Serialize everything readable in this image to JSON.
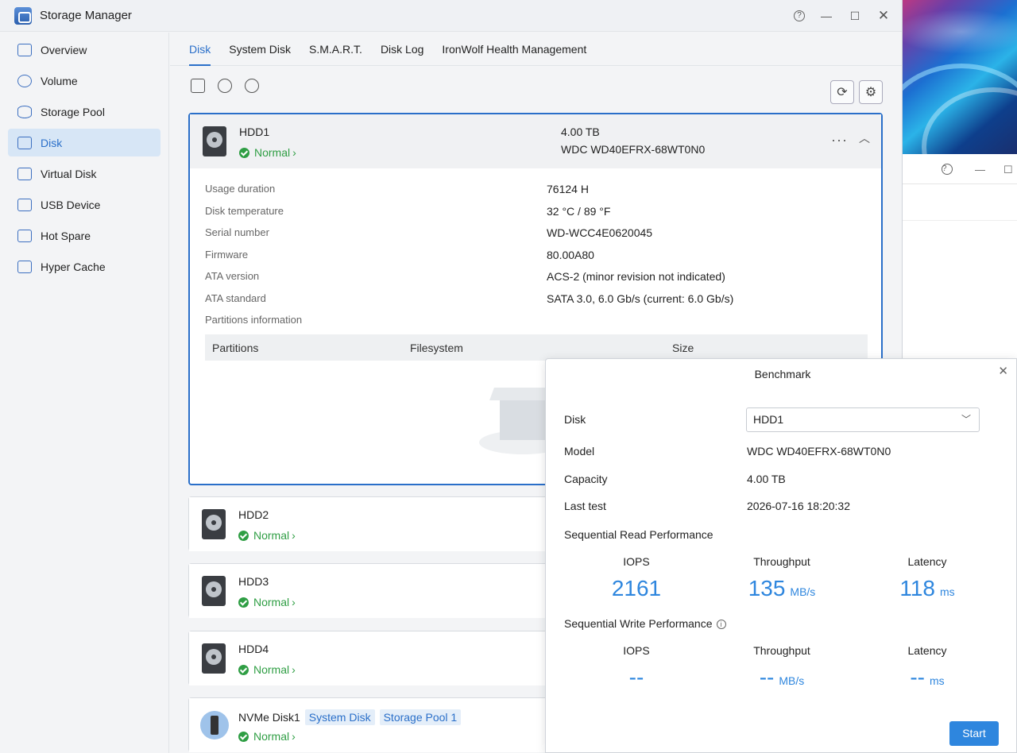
{
  "window": {
    "title": "Storage Manager"
  },
  "sidebar": {
    "items": [
      {
        "label": "Overview",
        "icon": "monitor-icon"
      },
      {
        "label": "Volume",
        "icon": "volume-icon"
      },
      {
        "label": "Storage Pool",
        "icon": "database-icon"
      },
      {
        "label": "Disk",
        "icon": "disk-icon",
        "active": true
      },
      {
        "label": "Virtual Disk",
        "icon": "virtual-disk-icon"
      },
      {
        "label": "USB Device",
        "icon": "usb-icon"
      },
      {
        "label": "Hot Spare",
        "icon": "hot-spare-icon"
      },
      {
        "label": "Hyper Cache",
        "icon": "ssd-icon"
      }
    ]
  },
  "tabs": [
    "Disk",
    "System Disk",
    "S.M.A.R.T.",
    "Disk Log",
    "IronWolf Health Management"
  ],
  "disks": [
    {
      "name": "HDD1",
      "status": "Normal",
      "capacity": "4.00 TB",
      "model": "WDC WD40EFRX-68WT0N0"
    },
    {
      "name": "HDD2",
      "status": "Normal"
    },
    {
      "name": "HDD3",
      "status": "Normal"
    },
    {
      "name": "HDD4",
      "status": "Normal"
    },
    {
      "name": "NVMe Disk1",
      "status": "Normal",
      "tags": [
        "System Disk",
        "Storage Pool 1"
      ]
    }
  ],
  "details": [
    {
      "key": "Usage duration",
      "value": "76124 H"
    },
    {
      "key": "Disk temperature",
      "value": "32 °C / 89 °F"
    },
    {
      "key": "Serial number",
      "value": "WD-WCC4E0620045"
    },
    {
      "key": "Firmware",
      "value": "80.00A80"
    },
    {
      "key": "ATA version",
      "value": "ACS-2 (minor revision not indicated)"
    },
    {
      "key": "ATA standard",
      "value": "SATA 3.0, 6.0 Gb/s (current: 6.0 Gb/s)"
    },
    {
      "key": "Partitions information",
      "value": ""
    }
  ],
  "partitions_table": {
    "headers": [
      "Partitions",
      "Filesystem",
      "Size"
    ]
  },
  "benchmark": {
    "title": "Benchmark",
    "disk_label": "Disk",
    "disk_value": "HDD1",
    "model_label": "Model",
    "model_value": "WDC WD40EFRX-68WT0N0",
    "capacity_label": "Capacity",
    "capacity_value": "4.00 TB",
    "last_test_label": "Last test",
    "last_test_value": "2026-07-16 18:20:32",
    "read_title": "Sequential Read Performance",
    "write_title": "Sequential Write Performance",
    "iops_label": "IOPS",
    "throughput_label": "Throughput",
    "latency_label": "Latency",
    "read": {
      "iops": "2161",
      "throughput": "135",
      "throughput_unit": "MB/s",
      "latency": "118",
      "latency_unit": "ms"
    },
    "write": {
      "iops": "--",
      "throughput": "--",
      "throughput_unit": "MB/s",
      "latency": "--",
      "latency_unit": "ms"
    },
    "start_label": "Start"
  },
  "colors": {
    "accent": "#2a6fc9",
    "ok": "#2f9e44",
    "metric": "#2e86de"
  }
}
